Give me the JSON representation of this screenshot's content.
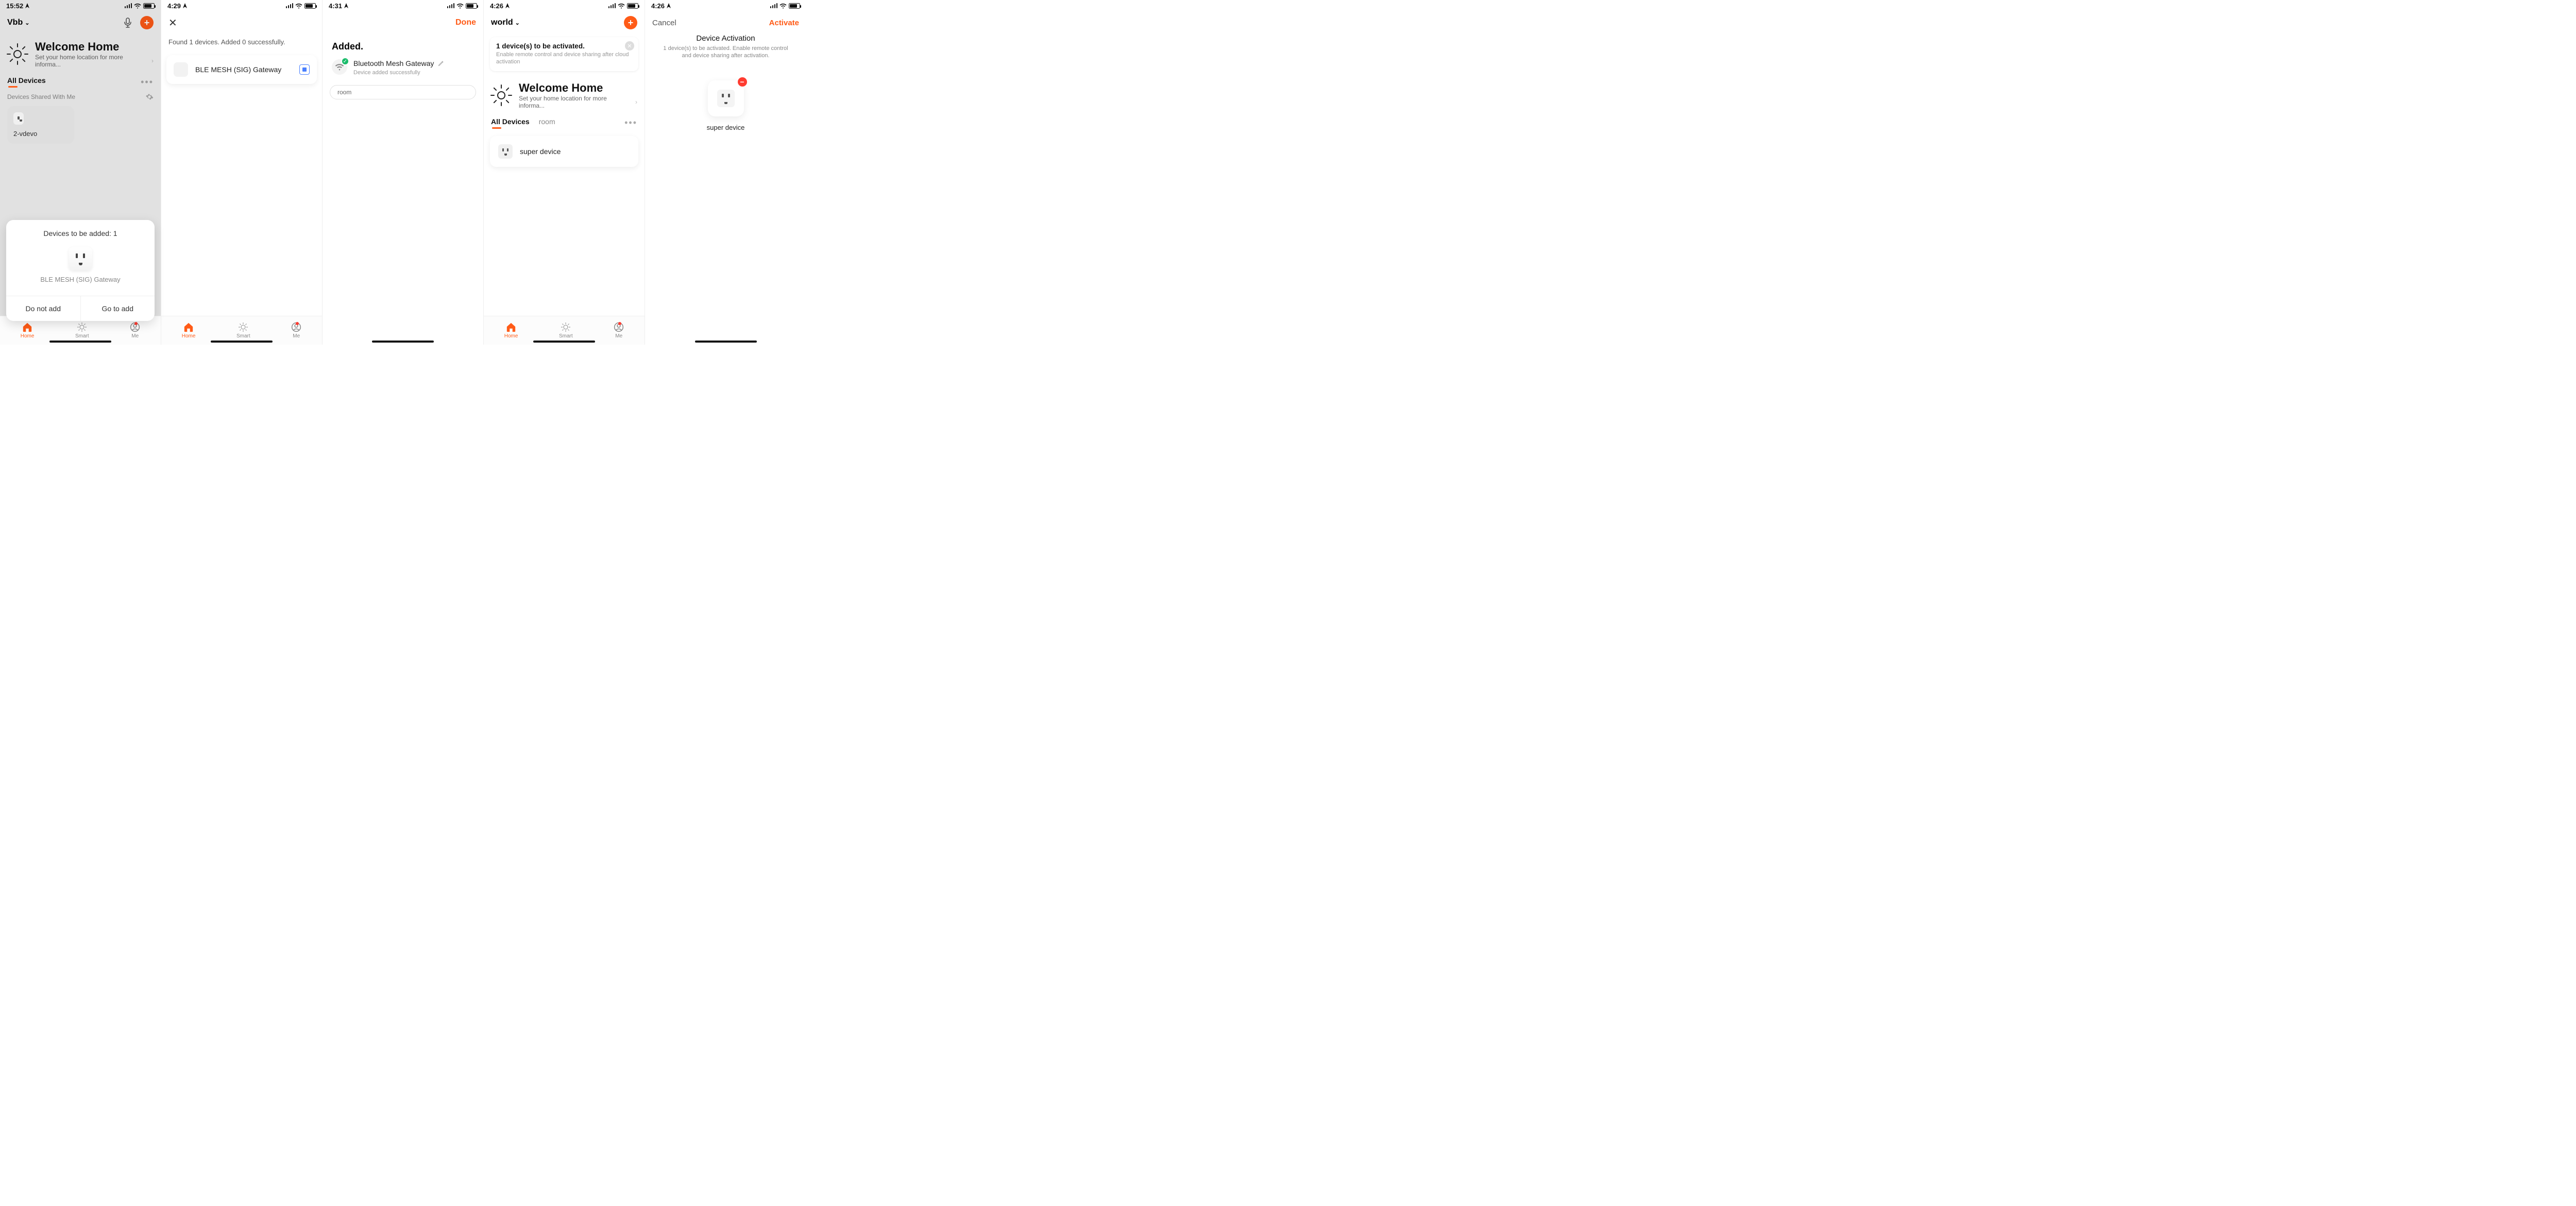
{
  "accent": "#ff5b17",
  "screen1": {
    "status": {
      "time": "15:52",
      "loc": true,
      "battery_pct": 70
    },
    "home_name": "Vbb",
    "welcome_title": "Welcome Home",
    "welcome_sub": "Set your home location for more informa...",
    "tab_all": "All Devices",
    "shared_label": "Devices Shared With Me",
    "tile_name": "2-vdevo",
    "sheet": {
      "title": "Devices to be added: 1",
      "device": "BLE MESH (SIG) Gateway",
      "btn_no": "Do not add",
      "btn_go": "Go to add"
    },
    "tabs": {
      "home": "Home",
      "smart": "Smart",
      "me": "Me"
    }
  },
  "screen2": {
    "status": {
      "time": "4:29",
      "battery_pct": 68
    },
    "summary": "Found 1 devices. Added 0 successfully.",
    "card_name": "BLE MESH (SIG) Gateway",
    "tabs": {
      "home": "Home",
      "smart": "Smart",
      "me": "Me"
    }
  },
  "screen3": {
    "status": {
      "time": "4:31",
      "battery_pct": 66
    },
    "done": "Done",
    "header": "Added.",
    "dev_name": "Bluetooth Mesh Gateway",
    "dev_sub": "Device added successfully",
    "chip_room": "room"
  },
  "screen4": {
    "status": {
      "time": "4:26",
      "battery_pct": 70
    },
    "home_name": "world",
    "banner_title": "1 device(s) to be activated.",
    "banner_sub": "Enable remote control and device sharing after cloud activation",
    "welcome_title": "Welcome Home",
    "welcome_sub": "Set your home location for more informa...",
    "tabs_row": {
      "all": "All Devices",
      "room": "room"
    },
    "device_name": "super device",
    "tabs": {
      "home": "Home",
      "smart": "Smart",
      "me": "Me"
    }
  },
  "screen5": {
    "status": {
      "time": "4:26",
      "battery_pct": 70
    },
    "cancel": "Cancel",
    "activate": "Activate",
    "title": "Device Activation",
    "sub": "1 device(s) to be activated. Enable remote control and device sharing after activation.",
    "device_name": "super device"
  }
}
